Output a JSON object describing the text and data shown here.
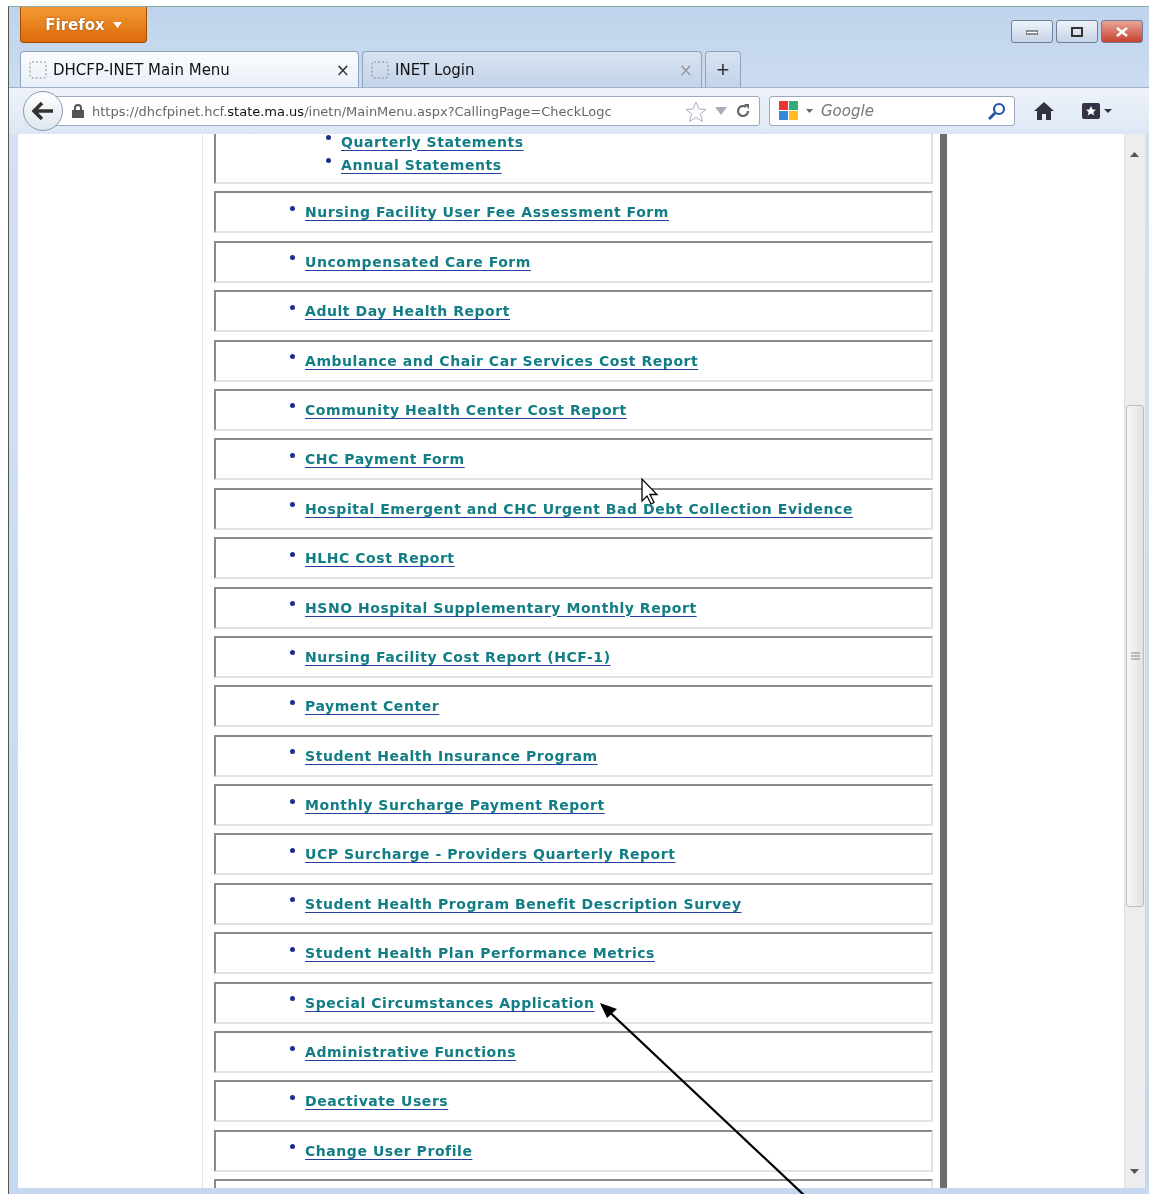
{
  "browser": {
    "menu_button": "Firefox",
    "tabs": [
      {
        "title": "DHCFP-INET Main Menu",
        "close": "×",
        "selected": true
      },
      {
        "title": "INET Login",
        "close": "×",
        "selected": false
      }
    ],
    "new_tab": "+",
    "url": {
      "prefix": "https://dhcfpinet.hcf.",
      "domain": "state.ma.us",
      "path": "/inetn/MainMenu.aspx?CallingPage=CheckLogc"
    },
    "search": {
      "placeholder": "Google"
    }
  },
  "menu": [
    {
      "kind": "sublist",
      "links": [
        "Quarterly Statements",
        "Annual Statements"
      ]
    },
    {
      "kind": "link",
      "label": "Nursing Facility User Fee Assessment Form"
    },
    {
      "kind": "link",
      "label": "Uncompensated Care Form"
    },
    {
      "kind": "link",
      "label": "Adult Day Health Report"
    },
    {
      "kind": "link",
      "label": "Ambulance and Chair Car Services Cost Report"
    },
    {
      "kind": "link",
      "label": "Community Health Center Cost Report"
    },
    {
      "kind": "link",
      "label": "CHC Payment Form"
    },
    {
      "kind": "link",
      "label": "Hospital Emergent and CHC Urgent Bad Debt Collection Evidence"
    },
    {
      "kind": "link",
      "label": "HLHC Cost Report"
    },
    {
      "kind": "link",
      "label": "HSNO Hospital Supplementary Monthly Report"
    },
    {
      "kind": "link",
      "label": "Nursing Facility Cost Report (HCF-1)"
    },
    {
      "kind": "link",
      "label": "Payment Center"
    },
    {
      "kind": "link",
      "label": "Student Health Insurance Program"
    },
    {
      "kind": "link",
      "label": "Monthly Surcharge Payment Report"
    },
    {
      "kind": "link",
      "label": "UCP Surcharge - Providers Quarterly Report"
    },
    {
      "kind": "link",
      "label": "Student Health Program Benefit Description Survey"
    },
    {
      "kind": "link",
      "label": "Student Health Plan Performance Metrics"
    },
    {
      "kind": "link",
      "label": "Special Circumstances Application"
    },
    {
      "kind": "link",
      "label": "Administrative Functions"
    },
    {
      "kind": "link",
      "label": "Deactivate Users"
    },
    {
      "kind": "link",
      "label": "Change User Profile"
    },
    {
      "kind": "blank"
    }
  ]
}
